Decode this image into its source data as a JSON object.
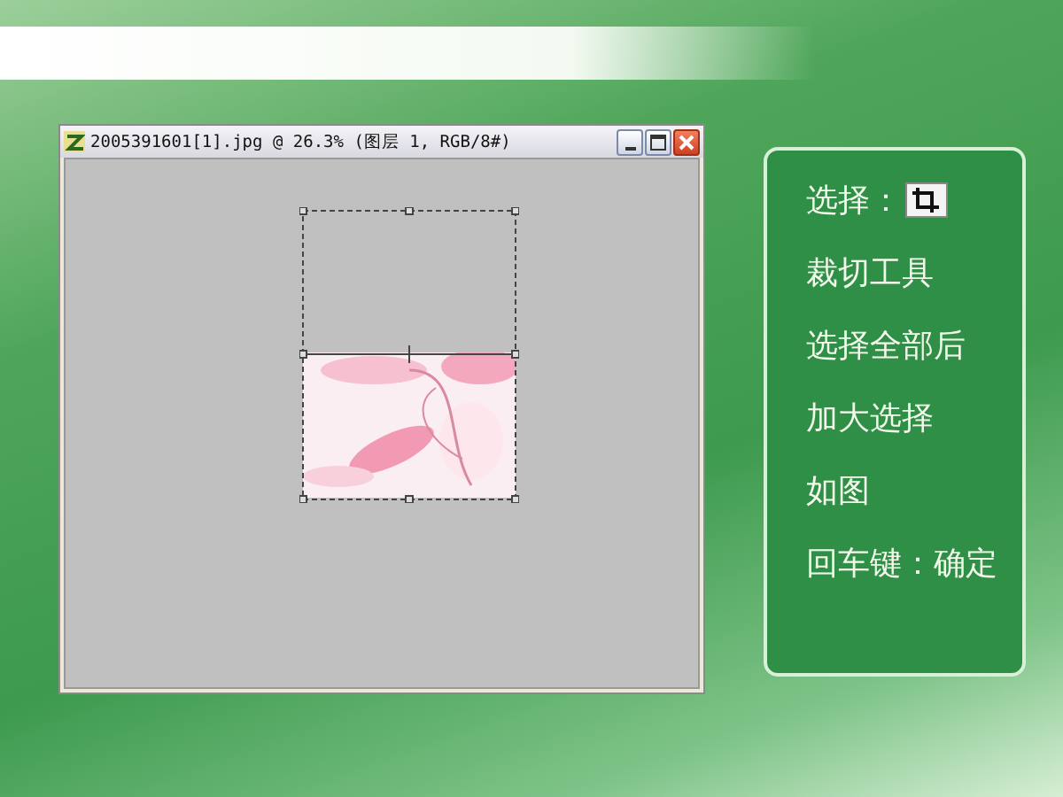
{
  "window": {
    "title": "2005391601[1].jpg @ 26.3% (图层 1, RGB/8#)"
  },
  "steps": [
    {
      "kind": "tool",
      "text": "选择："
    },
    {
      "kind": "text",
      "text": "裁切工具"
    },
    {
      "kind": "text",
      "text": "选择全部后"
    },
    {
      "kind": "text",
      "text": "加大选择"
    },
    {
      "kind": "text",
      "text": "如图"
    },
    {
      "kind": "text",
      "text": "回车键：确定"
    }
  ]
}
